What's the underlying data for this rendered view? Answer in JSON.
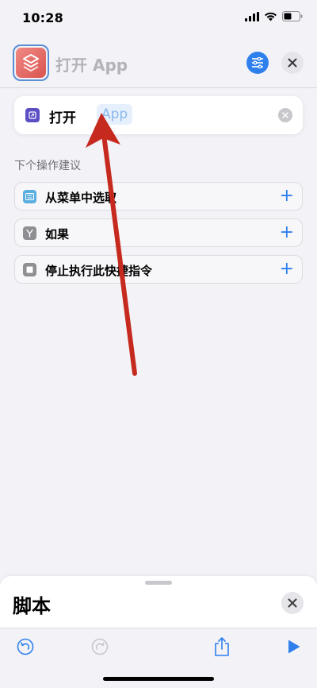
{
  "status_bar": {
    "time": "10:28"
  },
  "header": {
    "title": "打开 App"
  },
  "action": {
    "verb": "打开",
    "param_placeholder": "App"
  },
  "suggestions": {
    "title": "下个操作建议",
    "items": [
      {
        "label": "从菜单中选取",
        "icon": "menu-list-icon",
        "icon_color": "#5aaee0"
      },
      {
        "label": "如果",
        "icon": "branch-icon",
        "icon_color": "#8e8e93"
      },
      {
        "label": "停止执行此快捷指令",
        "icon": "stop-square-icon",
        "icon_color": "#8e8e93"
      }
    ],
    "add_symbol": "+"
  },
  "bottom_sheet": {
    "title": "脚本"
  },
  "colors": {
    "accent": "#2f80ed",
    "annotation_arrow": "#c62a1e",
    "app_icon": "#e2615b"
  }
}
